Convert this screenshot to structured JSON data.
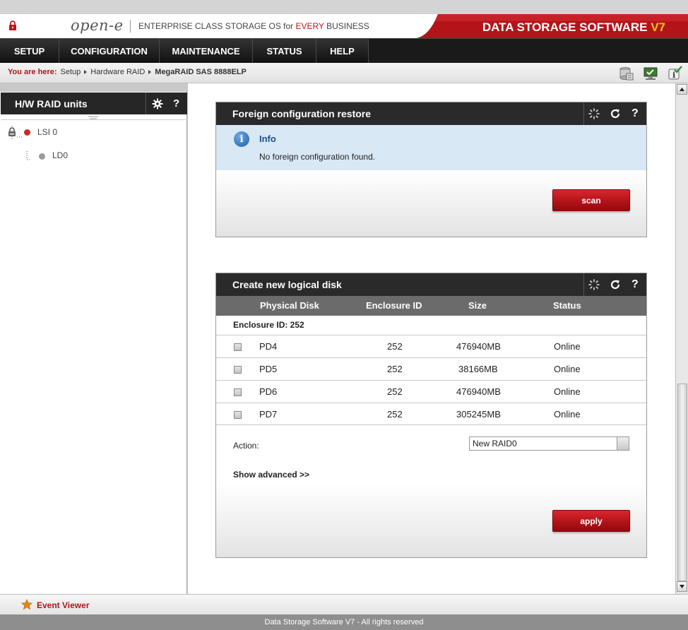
{
  "banner": {
    "logo": "open-e",
    "tagline_pre": "ENTERPRISE CLASS STORAGE OS for ",
    "tagline_hl": "EVERY",
    "tagline_post": " BUSINESS",
    "product": "DATA STORAGE SOFTWARE ",
    "version": "V7"
  },
  "menu": [
    "SETUP",
    "CONFIGURATION",
    "MAINTENANCE",
    "STATUS",
    "HELP"
  ],
  "breadcrumb": {
    "label": "You are here:",
    "items": [
      "Setup",
      "Hardware RAID",
      "MegaRAID SAS 8888ELP"
    ]
  },
  "left_panel": {
    "title": "H/W RAID units",
    "help": "?",
    "tree": [
      {
        "label": "LSI 0",
        "status_color": "#cc2a2a"
      },
      {
        "label": "LD0",
        "status_color": "#9a9a9a"
      }
    ]
  },
  "foreign_panel": {
    "title": "Foreign configuration restore",
    "help": "?",
    "info_title": "Info",
    "info_text": "No foreign configuration found.",
    "scan_label": "scan"
  },
  "create_panel": {
    "title": "Create new logical disk",
    "help": "?",
    "columns": [
      "Physical Disk",
      "Enclosure ID",
      "Size",
      "Status"
    ],
    "enclosure_label": "Enclosure ID: 252",
    "rows": [
      {
        "disk": "PD4",
        "enclosure": "252",
        "size": "476940MB",
        "status": "Online"
      },
      {
        "disk": "PD5",
        "enclosure": "252",
        "size": "38166MB",
        "status": "Online"
      },
      {
        "disk": "PD6",
        "enclosure": "252",
        "size": "476940MB",
        "status": "Online"
      },
      {
        "disk": "PD7",
        "enclosure": "252",
        "size": "305245MB",
        "status": "Online"
      }
    ],
    "action_label": "Action:",
    "action_value": "New RAID0",
    "show_advanced": "Show advanced >>",
    "apply_label": "apply"
  },
  "event_viewer": "Event Viewer",
  "footer": "Data Storage Software V7 - All rights reserved",
  "colors": {
    "accent_red": "#c0141b",
    "header_dark": "#262626",
    "info_bg": "#d8e8f5"
  }
}
